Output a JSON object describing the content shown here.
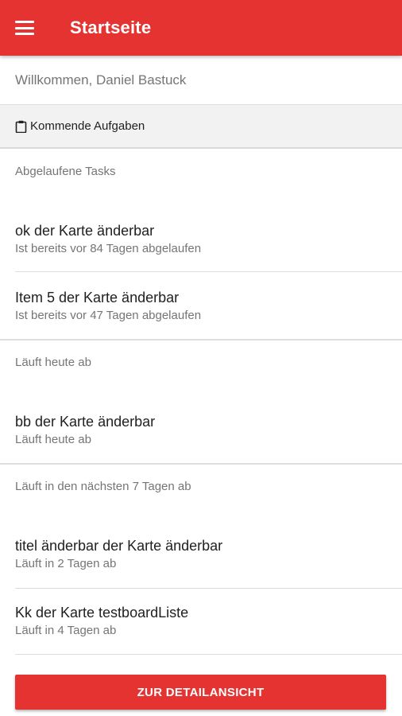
{
  "appbar": {
    "title": "Startseite",
    "menu_icon": "hamburger-menu-icon",
    "color": "#e53331"
  },
  "welcome": "Willkommen, Daniel Bastuck",
  "section": {
    "icon": "clipboard-icon",
    "label": "Kommende Aufgaben"
  },
  "groups": [
    {
      "header": "Abgelaufene Tasks",
      "tasks": [
        {
          "title": "ok der Karte änderbar",
          "subtitle": "Ist bereits vor 84 Tagen abgelaufen"
        },
        {
          "title": "Item 5 der Karte änderbar",
          "subtitle": "Ist bereits vor 47 Tagen abgelaufen"
        }
      ]
    },
    {
      "header": "Läuft heute ab",
      "tasks": [
        {
          "title": "bb der Karte änderbar",
          "subtitle": "Läuft heute ab"
        }
      ]
    },
    {
      "header": "Läuft in den nächsten 7 Tagen ab",
      "tasks": [
        {
          "title": "titel änderbar der Karte änderbar",
          "subtitle": "Läuft in 2 Tagen ab"
        },
        {
          "title": "Kk der Karte testboardListe",
          "subtitle": "Läuft in 4 Tagen ab"
        }
      ]
    }
  ],
  "detail_button": "ZUR DETAILANSICHT"
}
